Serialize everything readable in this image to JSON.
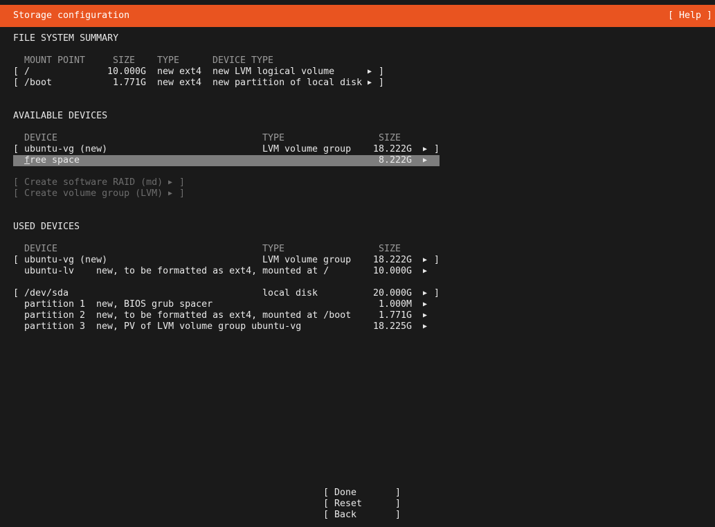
{
  "header": {
    "title": "Storage configuration",
    "help": "[ Help ]"
  },
  "fs_summary": {
    "heading": "FILE SYSTEM SUMMARY",
    "columns": [
      "MOUNT POINT",
      "SIZE",
      "TYPE",
      "DEVICE TYPE"
    ],
    "rows": [
      {
        "mount": "/",
        "size": "10.000G",
        "type": "new ext4",
        "device_type": "new LVM logical volume"
      },
      {
        "mount": "/boot",
        "size": "1.771G",
        "type": "new ext4",
        "device_type": "new partition of local disk"
      }
    ]
  },
  "available": {
    "heading": "AVAILABLE DEVICES",
    "columns": [
      "DEVICE",
      "TYPE",
      "SIZE"
    ],
    "vg": {
      "device": "ubuntu-vg (new)",
      "type": "LVM volume group",
      "size": "18.222G"
    },
    "free": {
      "first_letter": "f",
      "rest": "ree space",
      "size": "8.222G"
    },
    "actions": [
      "Create software RAID (md)",
      "Create volume group (LVM)"
    ]
  },
  "used": {
    "heading": "USED DEVICES",
    "columns": [
      "DEVICE",
      "TYPE",
      "SIZE"
    ],
    "vg": {
      "device": "ubuntu-vg (new)",
      "type": "LVM volume group",
      "size": "18.222G"
    },
    "lv": {
      "device": "ubuntu-lv",
      "desc": "new, to be formatted as ext4, mounted at /",
      "size": "10.000G"
    },
    "disk": {
      "device": "/dev/sda",
      "type": "local disk",
      "size": "20.000G"
    },
    "partitions": [
      {
        "name": "partition 1",
        "desc": "new, BIOS grub spacer",
        "size": "1.000M"
      },
      {
        "name": "partition 2",
        "desc": "new, to be formatted as ext4, mounted at /boot",
        "size": "1.771G"
      },
      {
        "name": "partition 3",
        "desc": "new, PV of LVM volume group ubuntu-vg",
        "size": "18.225G"
      }
    ]
  },
  "buttons": {
    "done": "Done",
    "reset": "Reset",
    "back": "Back"
  },
  "glyphs": {
    "open": "[",
    "close": "]",
    "arrow": "▶"
  },
  "colors": {
    "header": "#e95420",
    "background": "#1a1a1a",
    "selection": "#7d7d7d"
  }
}
